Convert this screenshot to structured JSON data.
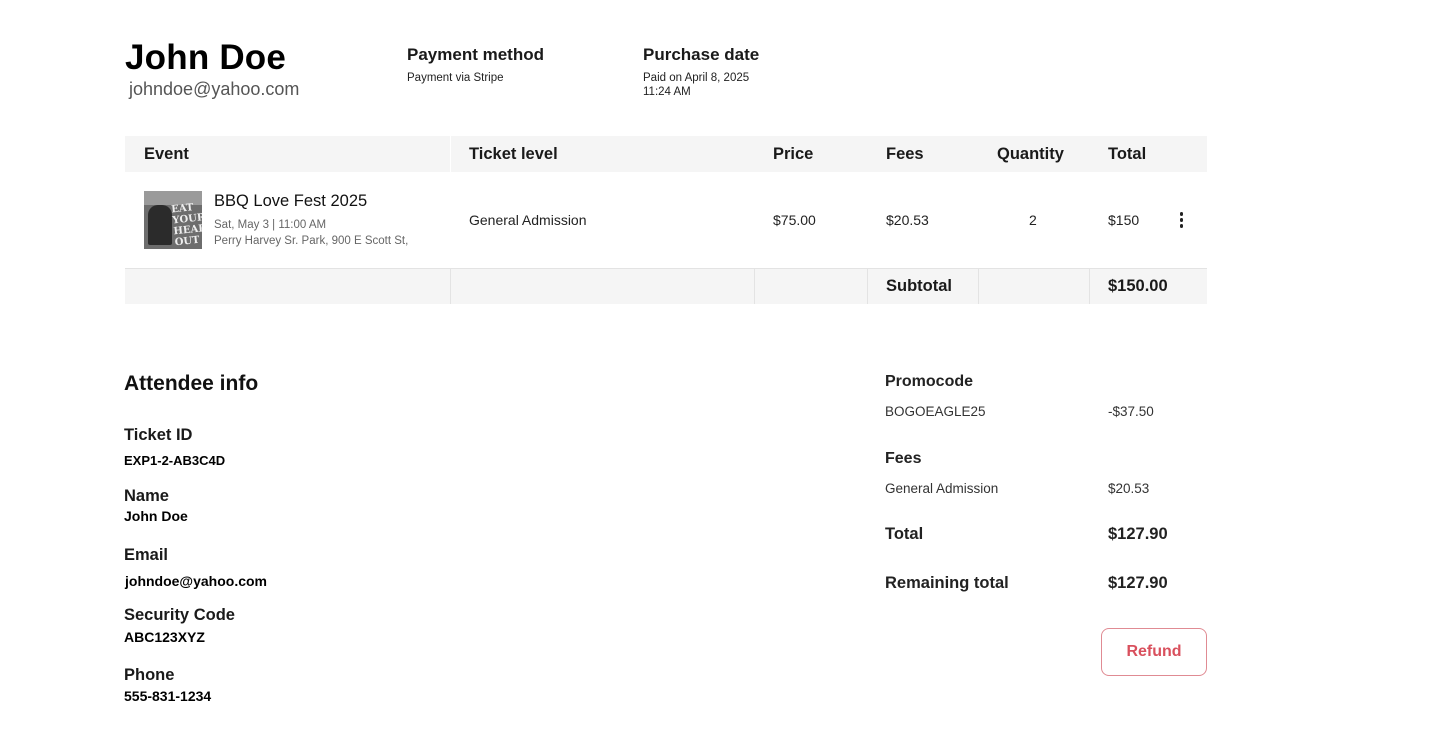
{
  "customer": {
    "name": "John Doe",
    "email": "johndoe@yahoo.com"
  },
  "payment": {
    "label": "Payment method",
    "value": "Payment via Stripe"
  },
  "purchase": {
    "label": "Purchase date",
    "date_line": "Paid on April 8, 2025",
    "time_line": "11:24 AM"
  },
  "table": {
    "headers": {
      "event": "Event",
      "ticket_level": "Ticket level",
      "price": "Price",
      "fees": "Fees",
      "quantity": "Quantity",
      "total": "Total"
    },
    "rows": [
      {
        "event_title": "BBQ Love Fest 2025",
        "event_datetime": "Sat, May 3 | 11:00 AM",
        "event_location": "Perry Harvey Sr. Park, 900 E Scott St,",
        "thumb_text": "EAT YOUR HEART OUT",
        "ticket_level": "General Admission",
        "price": "$75.00",
        "fees": "$20.53",
        "quantity": "2",
        "total": "$150"
      }
    ],
    "subtotal_label": "Subtotal",
    "subtotal_value": "$150.00"
  },
  "attendee": {
    "title": "Attendee info",
    "ticket_id_label": "Ticket ID",
    "ticket_id": "EXP1-2-AB3C4D",
    "name_label": "Name",
    "name": "John Doe",
    "email_label": "Email",
    "email": "johndoe@yahoo.com",
    "security_label": "Security Code",
    "security": "ABC123XYZ",
    "phone_label": "Phone",
    "phone": "555-831-1234"
  },
  "summary": {
    "promo_label": "Promocode",
    "promo_code": "BOGOEAGLE25",
    "promo_amount": "-$37.50",
    "fees_label": "Fees",
    "fees_item": "General Admission",
    "fees_amount": "$20.53",
    "total_label": "Total",
    "total_value": "$127.90",
    "remaining_label": "Remaining total",
    "remaining_value": "$127.90",
    "refund_label": "Refund"
  },
  "colors": {
    "header_bg": "#f5f5f5",
    "refund_text": "#d9505d",
    "refund_border": "#e08b93"
  }
}
